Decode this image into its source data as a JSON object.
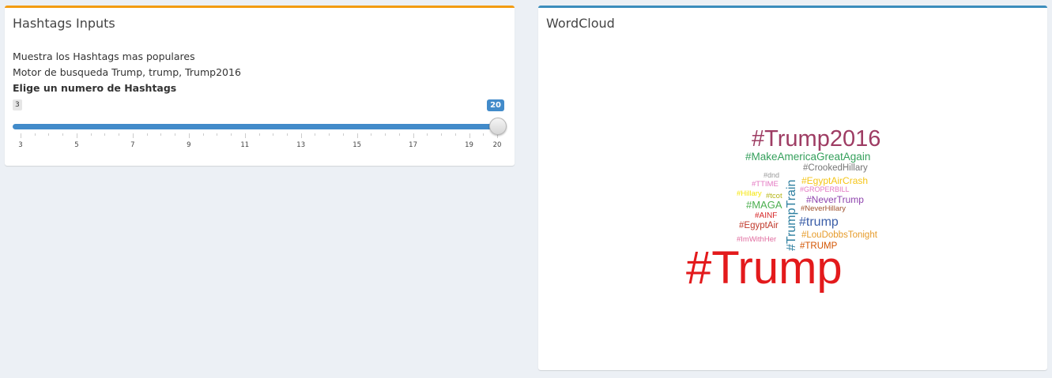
{
  "left_panel": {
    "title": "Hashtags Inputs",
    "line1": "Muestra los Hashtags mas populares",
    "line2": "Motor de busqueda Trump, trump, Trump2016",
    "slider": {
      "label": "Elige un numero de Hashtags",
      "min": 3,
      "max": 20,
      "value": 20,
      "min_label": "3",
      "value_label": "20",
      "tick_labels": [
        "3",
        "5",
        "7",
        "9",
        "11",
        "13",
        "15",
        "17",
        "19",
        "20"
      ]
    }
  },
  "right_panel": {
    "title": "WordCloud",
    "words": [
      {
        "text": "#Trump2016",
        "color": "#9e3c63"
      },
      {
        "text": "#MakeAmericaGreatAgain",
        "color": "#35a05c"
      },
      {
        "text": "#CrookedHillary",
        "color": "#777777"
      },
      {
        "text": "#dnd",
        "color": "#999999"
      },
      {
        "text": "#TTIME",
        "color": "#e377c2"
      },
      {
        "text": "#EgyptAirCrash",
        "color": "#f5c518"
      },
      {
        "text": "#GROPERBILL",
        "color": "#e377c2"
      },
      {
        "text": "#Hillary",
        "color": "#f5e60a"
      },
      {
        "text": "#tcot",
        "color": "#b5b518"
      },
      {
        "text": "#NeverTrump",
        "color": "#8e44ad"
      },
      {
        "text": "#MAGA",
        "color": "#4caf50"
      },
      {
        "text": "#NeverHillary",
        "color": "#a0522d"
      },
      {
        "text": "#AINF",
        "color": "#d62728"
      },
      {
        "text": "#trump",
        "color": "#3b5ea8"
      },
      {
        "text": "#EgyptAir",
        "color": "#c0392b"
      },
      {
        "text": "#LouDobbsTonight",
        "color": "#e69b2a"
      },
      {
        "text": "#ImWithHer",
        "color": "#e06c9f"
      },
      {
        "text": "#TRUMP",
        "color": "#d35400"
      },
      {
        "text": "#TrumpTrain",
        "color": "#2e7fa0"
      },
      {
        "text": "#Trump",
        "color": "#e31a1c"
      }
    ]
  }
}
